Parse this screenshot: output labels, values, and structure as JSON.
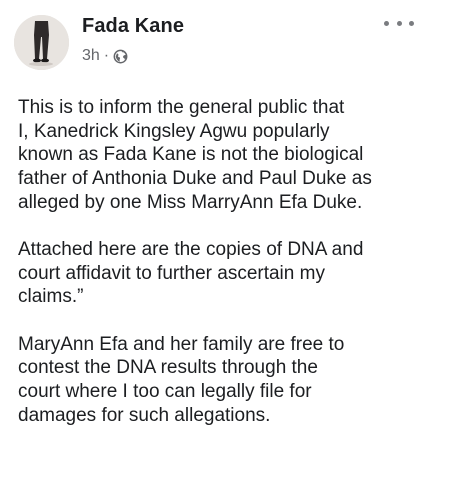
{
  "post": {
    "author": "Fada Kane",
    "time": "3h",
    "separator": "·",
    "privacy_icon": "globe-icon",
    "more_icon": "more-options-icon",
    "paragraphs": [
      "This is to inform the general public that\nI, Kanedrick Kingsley Agwu popularly\nknown as Fada Kane is not the biological\nfather of Anthonia Duke and Paul Duke as\nalleged by one Miss MarryAnn Efa Duke.",
      "Attached here are the copies of DNA and\ncourt affidavit to further ascertain my\nclaims.”",
      "MaryAnn Efa and her family are free to\ncontest the DNA results through the\ncourt where I too can legally file for\ndamages for such allegations."
    ]
  },
  "colors": {
    "text": "#1c1e21",
    "secondary_text": "#65676b",
    "background": "#ffffff"
  }
}
